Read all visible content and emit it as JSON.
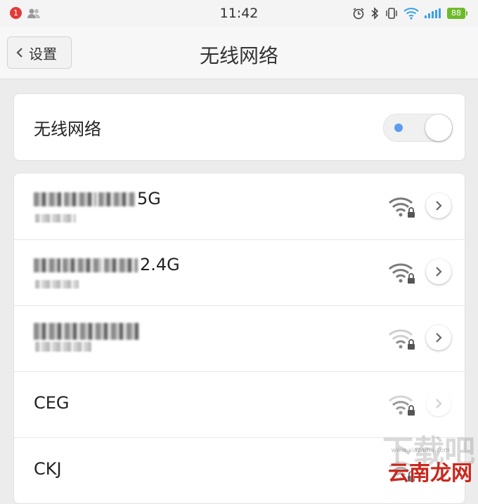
{
  "status_bar": {
    "notification_count": "1",
    "time": "11:42",
    "battery": "88",
    "icons": [
      "user-icon",
      "alarm-icon",
      "bluetooth-icon",
      "vibrate-icon",
      "wifi-icon",
      "signal-icon",
      "battery-icon"
    ]
  },
  "navbar": {
    "back_label": "设置",
    "title": "无线网络"
  },
  "toggle": {
    "label": "无线网络",
    "state": "on"
  },
  "networks": [
    {
      "ssid_suffix": "5G",
      "obscured": true,
      "secured": true,
      "signal": "strong"
    },
    {
      "ssid_suffix": "2.4G",
      "obscured": true,
      "secured": true,
      "signal": "strong"
    },
    {
      "ssid_suffix": "",
      "obscured": true,
      "secured": true,
      "signal": "weak"
    },
    {
      "ssid": "CEG",
      "obscured": false,
      "secured": true,
      "signal": "weak"
    },
    {
      "ssid": "CKJ",
      "obscured": false,
      "secured": true,
      "signal": "weak"
    }
  ],
  "watermark": {
    "text": "云南龙网",
    "bg_text": "下载吧",
    "url": "www.xiazaiba.com"
  },
  "colors": {
    "accent_blue": "#5b9cf0",
    "battery_green": "#6dbb2c",
    "badge_red": "#e03a3a",
    "watermark_red": "#c8281e"
  }
}
